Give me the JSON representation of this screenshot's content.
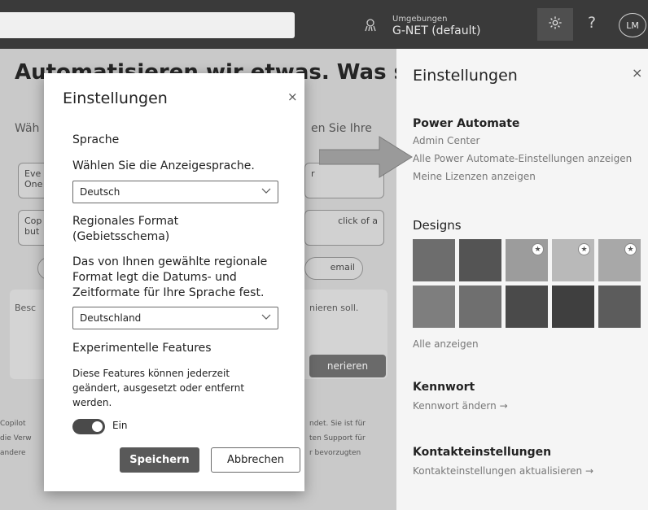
{
  "topbar": {
    "env_label": "Umgebungen",
    "env_value": "G-NET (default)",
    "help": "?",
    "avatar_initials": "LM"
  },
  "background": {
    "heading": "Automatisieren wir etwas. Was soll",
    "sub_left": "Wäh",
    "sub_right": "en Sie Ihre",
    "cards": [
      "Eve\nOne",
      "Cop\nbut",
      "click of a",
      "r"
    ],
    "pill_right": "email",
    "panel_text_left": "Besc",
    "panel_text_right": "nieren soll.",
    "generate_button": "nerieren",
    "footer": [
      {
        "left": "Copilot",
        "right": "ndet. Sie ist für"
      },
      {
        "left": "die Verw",
        "right": "ten Support für"
      },
      {
        "left": "andere",
        "right": "r bevorzugten"
      }
    ]
  },
  "settings_panel": {
    "title": "Einstellungen",
    "close": "×",
    "power_automate": {
      "title": "Power Automate",
      "links": [
        "Admin Center",
        "Alle Power Automate-Einstellungen anzeigen",
        "Meine Lizenzen anzeigen"
      ]
    },
    "designs": {
      "title": "Designs",
      "show_all": "Alle anzeigen",
      "tiles": [
        {
          "color": "#6d6d6d",
          "star": false
        },
        {
          "color": "#545454",
          "star": false
        },
        {
          "color": "#9c9c9c",
          "star": true
        },
        {
          "color": "#b9b9b9",
          "star": true
        },
        {
          "color": "#a8a8a8",
          "star": true
        },
        {
          "color": "#7e7e7e",
          "star": false
        },
        {
          "color": "#6f6f6f",
          "star": false
        },
        {
          "color": "#4a4a4a",
          "star": false
        },
        {
          "color": "#3f3f3f",
          "star": false
        },
        {
          "color": "#5c5c5c",
          "star": false
        }
      ]
    },
    "password": {
      "title": "Kennwort",
      "link": "Kennwort ändern →"
    },
    "contact": {
      "title": "Kontakteinstellungen",
      "link": "Kontakteinstellungen aktualisieren →"
    }
  },
  "modal": {
    "title": "Einstellungen",
    "close": "×",
    "language_heading": "Sprache",
    "language_label": "Wählen Sie die Anzeigesprache.",
    "language_value": "Deutsch",
    "region_heading_1": "Regionales Format",
    "region_heading_2": "(Gebietsschema)",
    "region_desc_1": "Das von Ihnen gewählte regionale",
    "region_desc_2": "Format legt die Datums- und",
    "region_desc_3": "Zeitformate für Ihre Sprache fest.",
    "region_value": "Deutschland",
    "experimental_heading": "Experimentelle Features",
    "experimental_desc_1": "Diese Features können jederzeit",
    "experimental_desc_2": "geändert, ausgesetzt oder entfernt",
    "experimental_desc_3": "werden.",
    "toggle_label": "Ein",
    "save": "Speichern",
    "cancel": "Abbrechen"
  }
}
